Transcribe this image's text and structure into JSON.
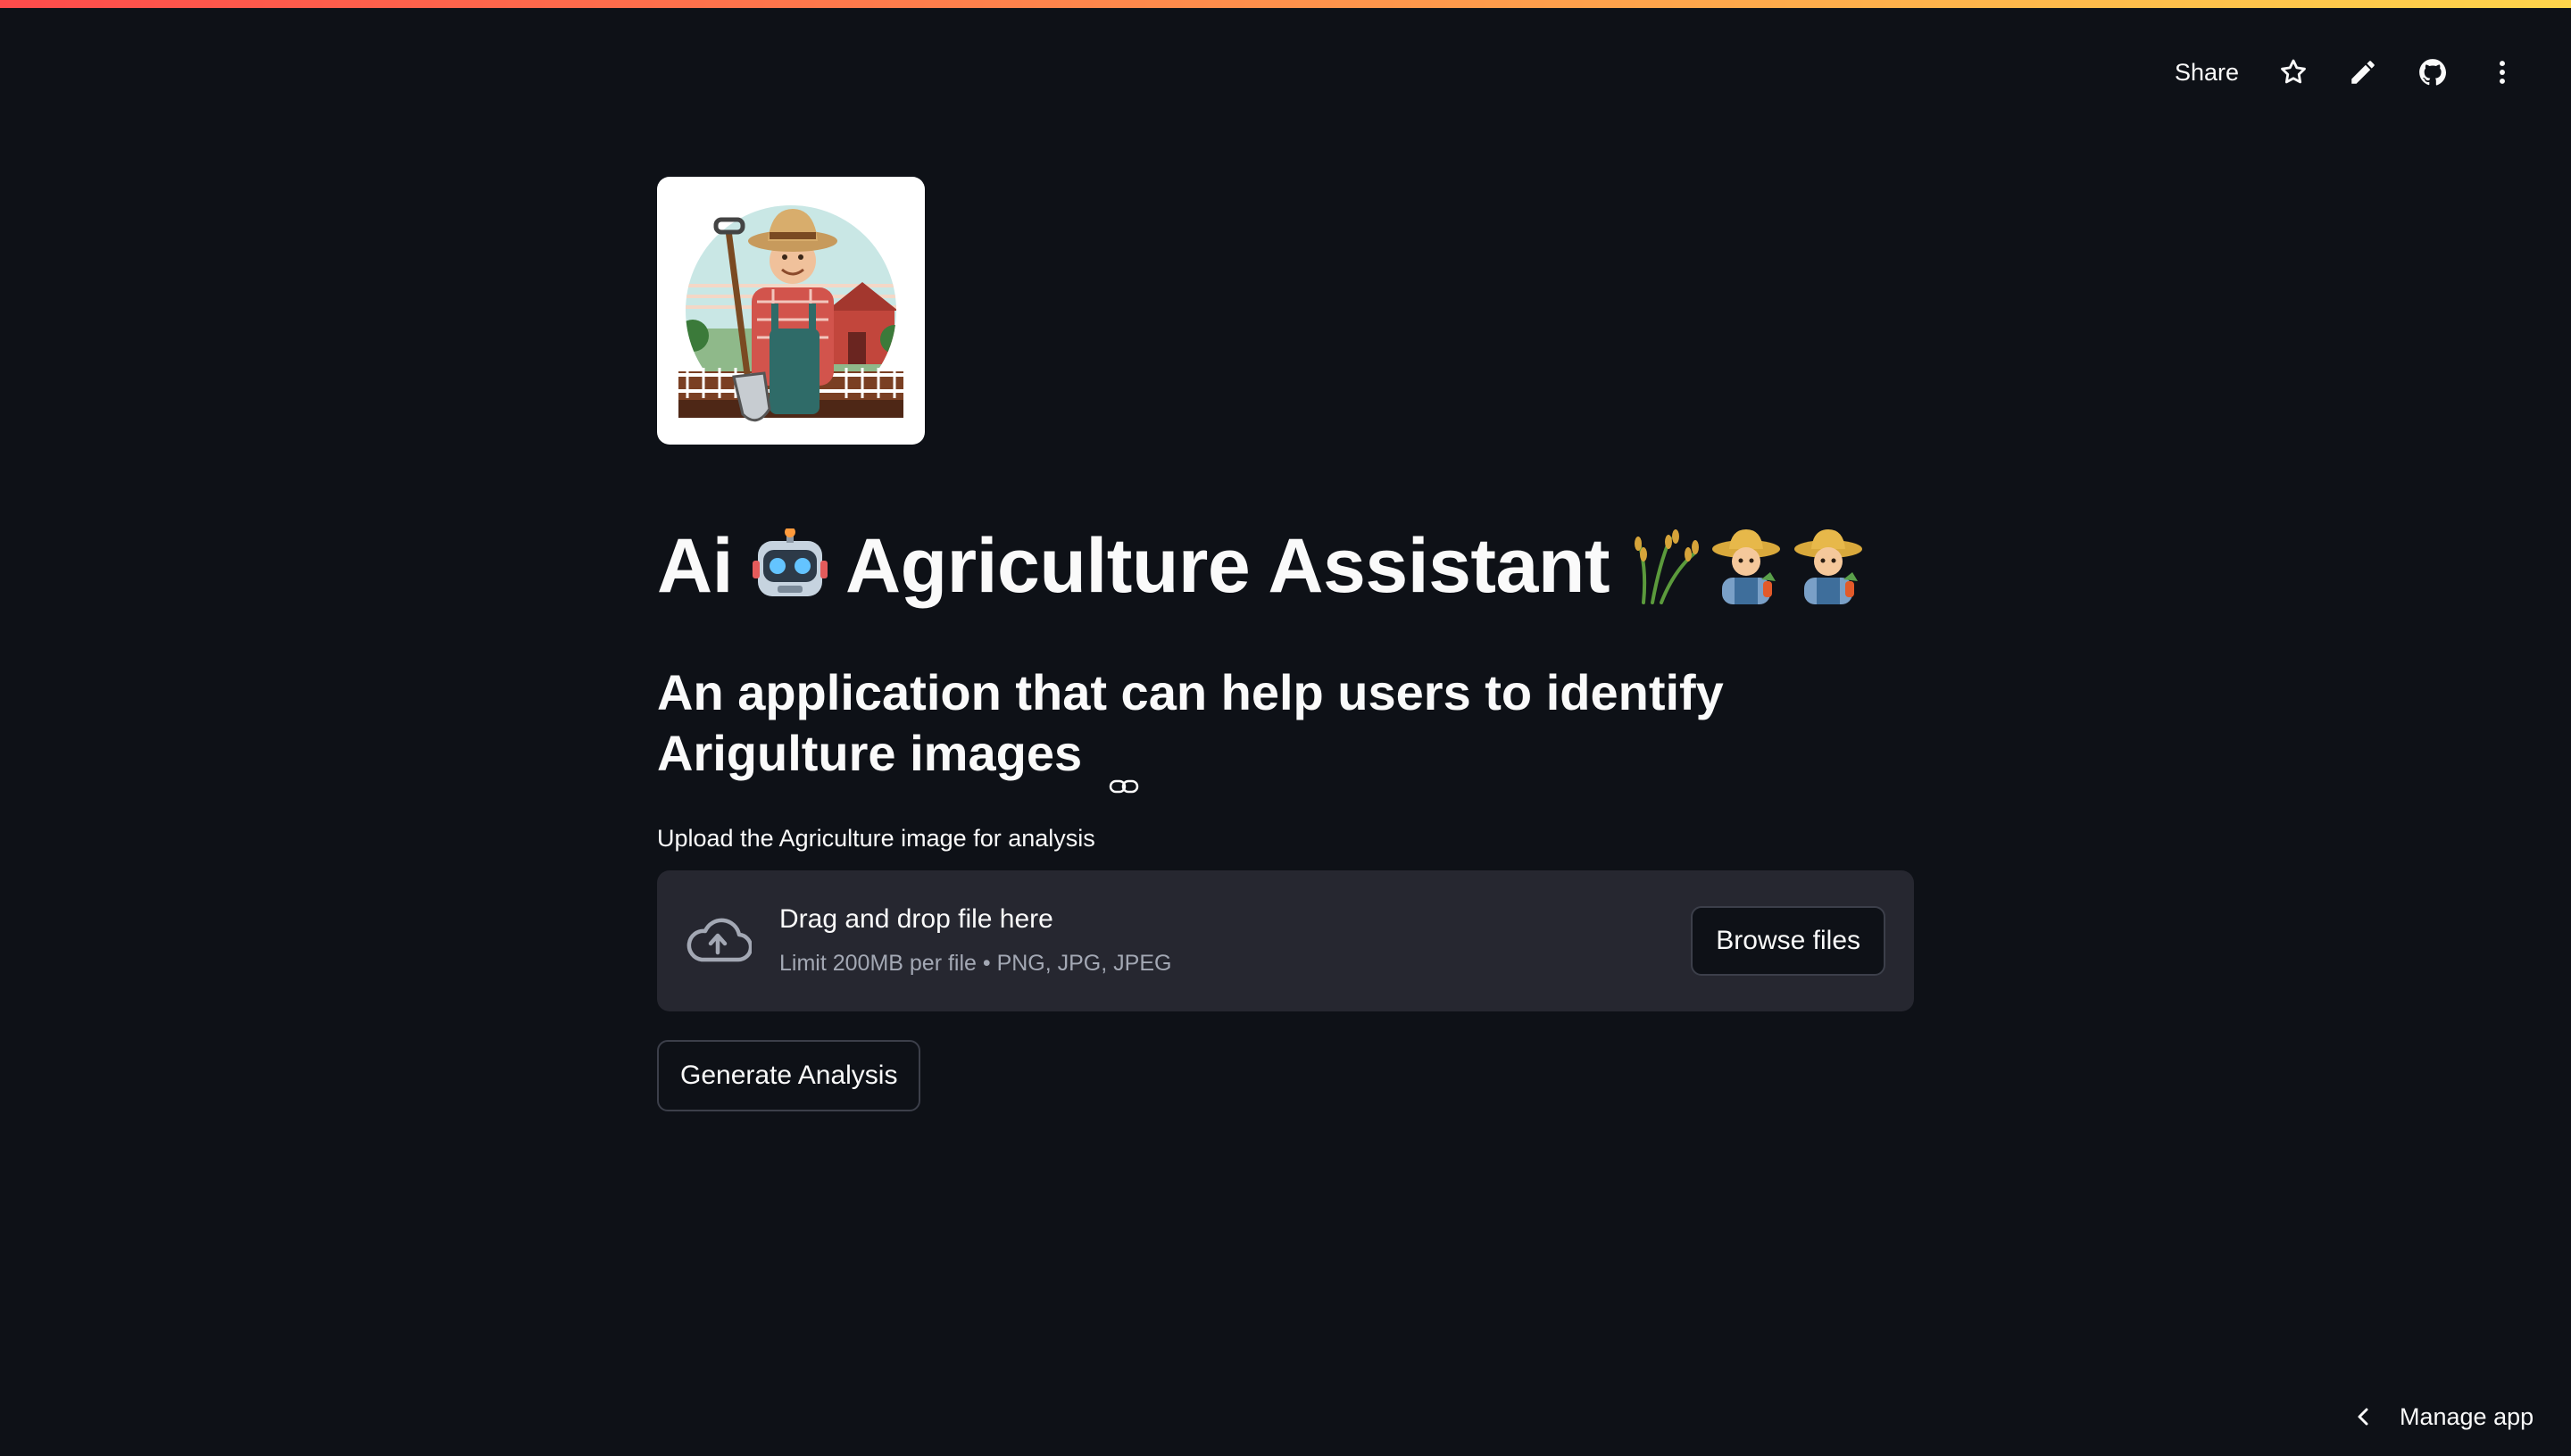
{
  "header": {
    "share_label": "Share",
    "icons": [
      "star-icon",
      "edit-pencil-icon",
      "github-icon",
      "more-vertical-icon"
    ]
  },
  "logo": {
    "alt": "farmer-logo"
  },
  "title": {
    "prefix": "Ai",
    "main": "Agriculture Assistant",
    "emojis": [
      "robot-emoji",
      "rice-sheaf-emoji",
      "farmer-emoji",
      "farmer-emoji"
    ]
  },
  "subtitle": {
    "text": "An application that can help users to identify Arigulture images"
  },
  "uploader": {
    "label": "Upload the Agriculture image for analysis",
    "dropzone_title": "Drag and drop file here",
    "dropzone_limit": "Limit 200MB per file • PNG, JPG, JPEG",
    "browse_label": "Browse files"
  },
  "actions": {
    "generate_label": "Generate Analysis"
  },
  "footer": {
    "manage_label": "Manage app"
  },
  "colors": {
    "background": "#0e1117",
    "surface": "#262730",
    "text": "#fafafa",
    "muted_text": "#a3a8b4",
    "accent_stripe_start": "#ff4b4b",
    "accent_stripe_end": "#ffd54b"
  }
}
